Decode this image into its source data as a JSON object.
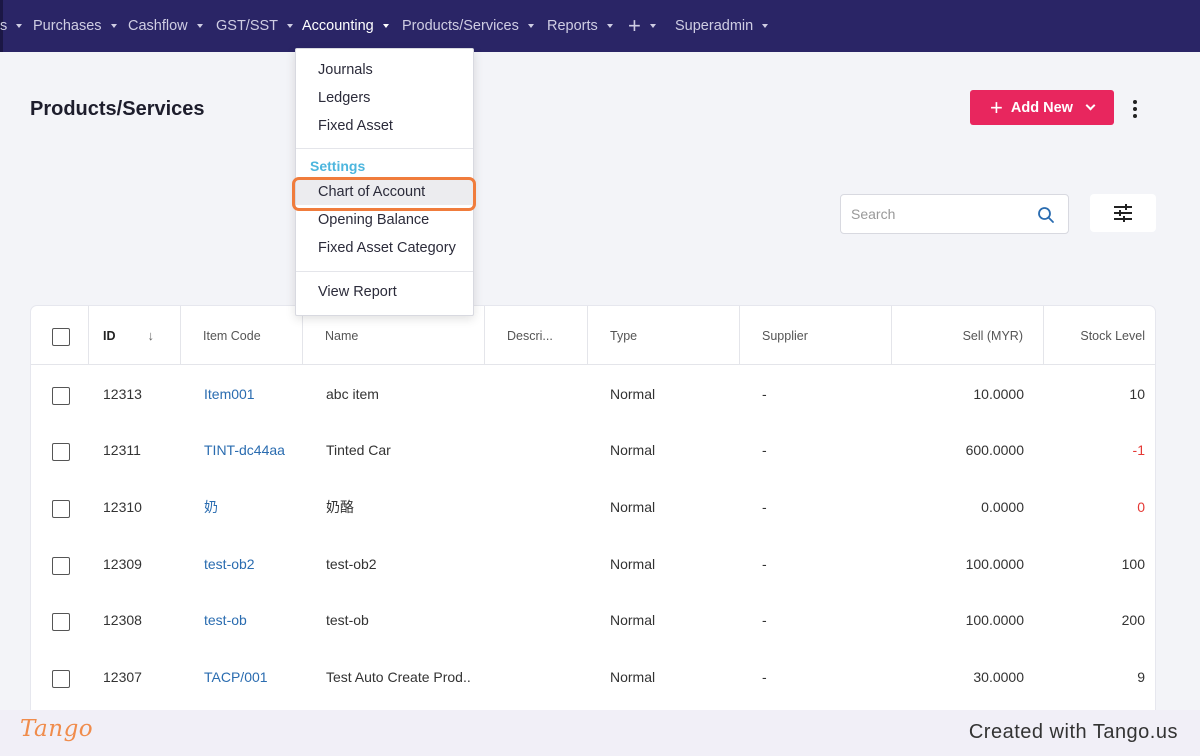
{
  "nav": {
    "items": [
      {
        "label": "s"
      },
      {
        "label": "Purchases"
      },
      {
        "label": "Cashflow"
      },
      {
        "label": "GST/SST"
      },
      {
        "label": "Accounting"
      },
      {
        "label": "Products/Services"
      },
      {
        "label": "Reports"
      },
      {
        "label": "Superadmin"
      }
    ],
    "plus_icon": "+"
  },
  "page": {
    "title": "Products/Services",
    "add_new_label": "Add New",
    "search_placeholder": "Search"
  },
  "dropdown": {
    "group1": [
      "Journals",
      "Ledgers",
      "Fixed Asset"
    ],
    "section_label": "Settings",
    "group2": [
      "Chart of Account",
      "Opening Balance",
      "Fixed Asset Category"
    ],
    "group3": [
      "View Report"
    ],
    "highlighted_item": "Chart of Account"
  },
  "table": {
    "headers": {
      "id": "ID",
      "item_code": "Item Code",
      "name": "Name",
      "description": "Descri...",
      "type": "Type",
      "supplier": "Supplier",
      "sell": "Sell (MYR)",
      "stock": "Stock Level"
    },
    "rows": [
      {
        "id": "12313",
        "code": "Item001",
        "name": "abc item",
        "type": "Normal",
        "supplier": "-",
        "sell": "10.0000",
        "stock": "10"
      },
      {
        "id": "12311",
        "code": "TINT-dc44aa",
        "name": "Tinted Car",
        "type": "Normal",
        "supplier": "-",
        "sell": "600.0000",
        "stock": "-1"
      },
      {
        "id": "12310",
        "code": "奶",
        "name": "奶酪",
        "type": "Normal",
        "supplier": "-",
        "sell": "0.0000",
        "stock": "0"
      },
      {
        "id": "12309",
        "code": "test-ob2",
        "name": "test-ob2",
        "type": "Normal",
        "supplier": "-",
        "sell": "100.0000",
        "stock": "100"
      },
      {
        "id": "12308",
        "code": "test-ob",
        "name": "test-ob",
        "type": "Normal",
        "supplier": "-",
        "sell": "100.0000",
        "stock": "200"
      },
      {
        "id": "12307",
        "code": "TACP/001",
        "name": "Test Auto Create Prod...",
        "type": "Normal",
        "supplier": "-",
        "sell": "30.0000",
        "stock": "9"
      }
    ]
  },
  "footer": {
    "logo_text": "Tango",
    "created_with": "Created with Tango.us"
  },
  "colors": {
    "nav_bg": "#2a2566",
    "accent_button": "#e8265e",
    "link": "#2a6cb0",
    "negative": "#e53935",
    "settings_label": "#4db6de",
    "highlight_ring": "#f07c3c"
  }
}
